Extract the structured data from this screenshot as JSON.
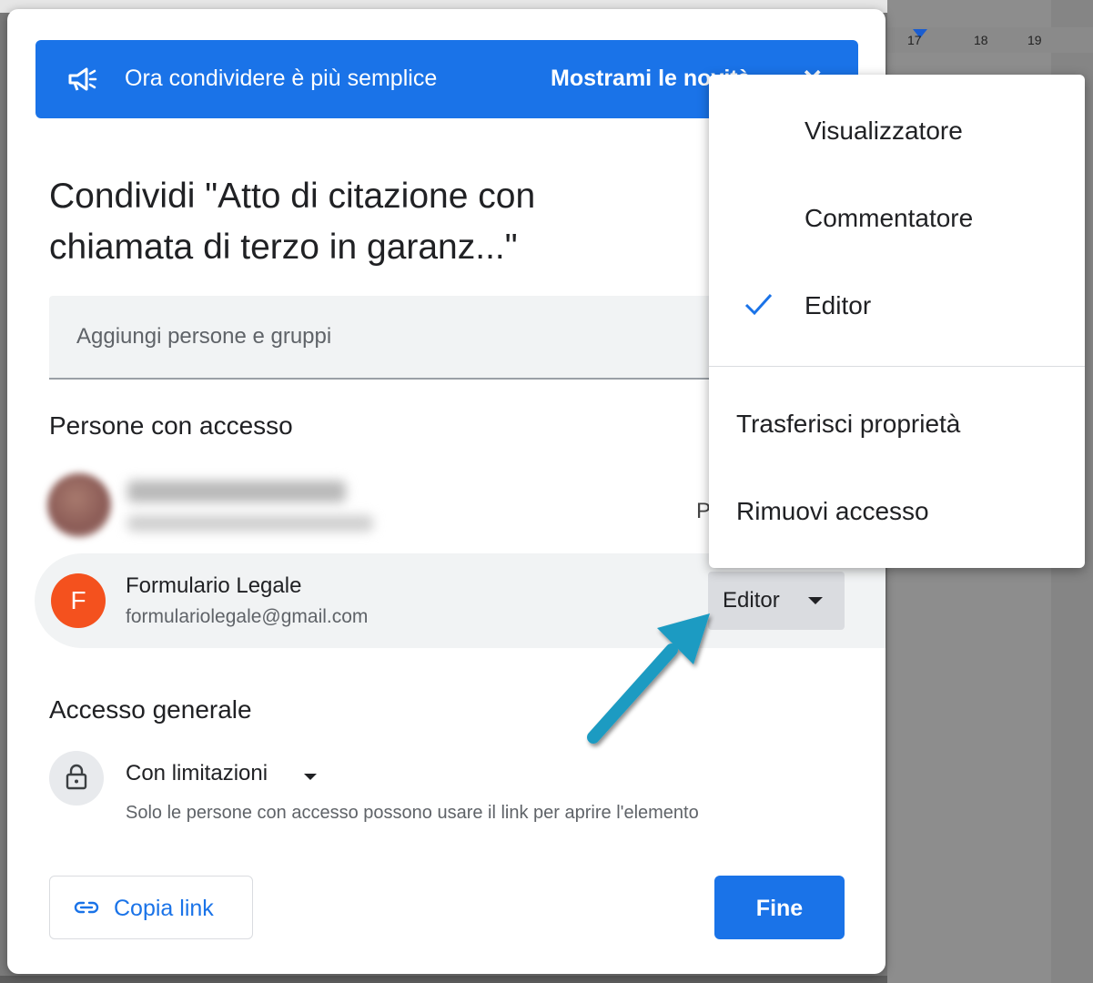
{
  "background": {
    "ruler_ticks": [
      "17",
      "18",
      "19"
    ]
  },
  "banner": {
    "icon": "megaphone-icon",
    "text": "Ora condividere è più semplice",
    "link": "Mostrami le novità",
    "close_icon": "close-icon"
  },
  "dialog": {
    "title": "Condividi \"Atto di citazione con chiamata di terzo in garanz...\"",
    "add_placeholder": "Aggiungi persone e gruppi",
    "people_heading": "Persone con accesso",
    "hidden_role_initial": "P",
    "person": {
      "initial": "F",
      "name": "Formulario Legale",
      "email": "formulariolegale@gmail.com",
      "role": "Editor"
    },
    "general_heading": "Accesso generale",
    "general": {
      "icon": "lock-icon",
      "mode": "Con limitazioni",
      "description": "Solo le persone con accesso possono usare il link per aprire l'elemento"
    },
    "copy_link": "Copia link",
    "done": "Fine"
  },
  "role_menu": {
    "items": [
      "Visualizzatore",
      "Commentatore",
      "Editor"
    ],
    "selected": "Editor",
    "actions": [
      "Trasferisci proprietà",
      "Rimuovi accesso"
    ]
  },
  "colors": {
    "accent": "#1a73e8",
    "avatar": "#f4511e",
    "arrow": "#1f9bc2"
  }
}
